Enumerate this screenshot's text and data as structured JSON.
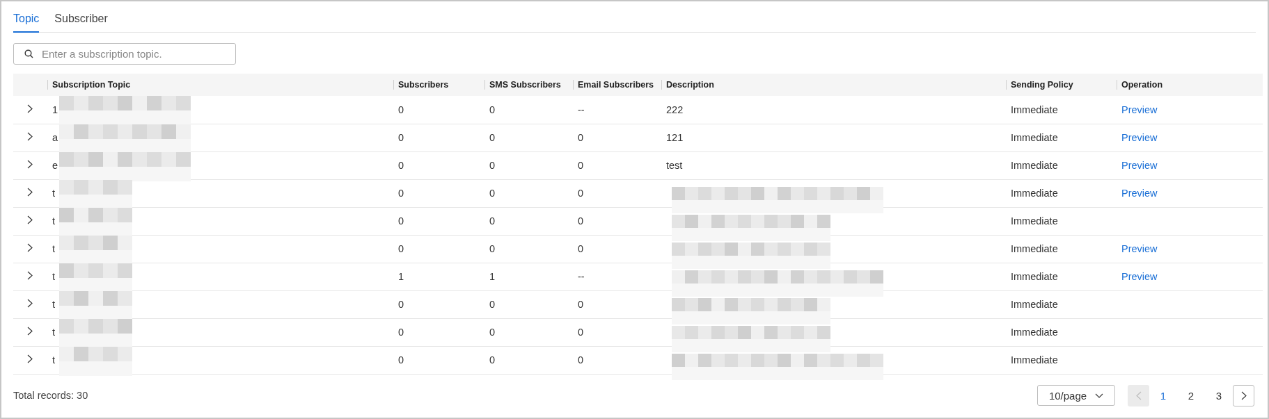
{
  "tabs": [
    {
      "label": "Topic",
      "selected": true
    },
    {
      "label": "Subscriber",
      "selected": false
    }
  ],
  "search": {
    "placeholder": "Enter a subscription topic."
  },
  "table": {
    "columns": [
      "Subscription Topic",
      "Subscribers",
      "SMS Subscribers",
      "Email Subscribers",
      "Description",
      "Sending Policy",
      "Operation"
    ],
    "rows": [
      {
        "topic": "1",
        "topic_redacted": true,
        "subscribers": "0",
        "sms": "0",
        "email": "--",
        "description": "222",
        "description_redacted": false,
        "policy": "Immediate",
        "operation": "Preview"
      },
      {
        "topic": "a",
        "topic_redacted": true,
        "subscribers": "0",
        "sms": "0",
        "email": "0",
        "description": "121",
        "description_redacted": false,
        "policy": "Immediate",
        "operation": "Preview"
      },
      {
        "topic": "e",
        "topic_redacted": true,
        "subscribers": "0",
        "sms": "0",
        "email": "0",
        "description": "test",
        "description_redacted": false,
        "policy": "Immediate",
        "operation": "Preview"
      },
      {
        "topic": "t",
        "topic_redacted": true,
        "subscribers": "0",
        "sms": "0",
        "email": "0",
        "description_redacted": true,
        "policy": "Immediate",
        "operation": "Preview"
      },
      {
        "topic": "t",
        "topic_redacted": true,
        "subscribers": "0",
        "sms": "0",
        "email": "0",
        "description_redacted": true,
        "policy": "Immediate"
      },
      {
        "topic": "t",
        "topic_redacted": true,
        "subscribers": "0",
        "sms": "0",
        "email": "0",
        "description_redacted": true,
        "policy": "Immediate",
        "operation": "Preview"
      },
      {
        "topic": "t",
        "topic_redacted": true,
        "subscribers": "1",
        "sms": "1",
        "email": "--",
        "description_redacted": true,
        "policy": "Immediate",
        "operation": "Preview"
      },
      {
        "topic": "t",
        "topic_redacted": true,
        "subscribers": "0",
        "sms": "0",
        "email": "0",
        "description_redacted": true,
        "policy": "Immediate"
      },
      {
        "topic": "t",
        "topic_redacted": true,
        "subscribers": "0",
        "sms": "0",
        "email": "0",
        "description_redacted": true,
        "policy": "Immediate"
      },
      {
        "topic": "t",
        "topic_redacted": true,
        "subscribers": "0",
        "sms": "0",
        "email": "0",
        "description_redacted": true,
        "policy": "Immediate"
      }
    ]
  },
  "footer": {
    "total": "Total records: 30",
    "page_size": "10/page",
    "pages": [
      {
        "label": "1",
        "selected": true
      },
      {
        "label": "2",
        "selected": false
      },
      {
        "label": "3",
        "selected": false
      }
    ],
    "prev_disabled": true,
    "next_disabled": false
  }
}
